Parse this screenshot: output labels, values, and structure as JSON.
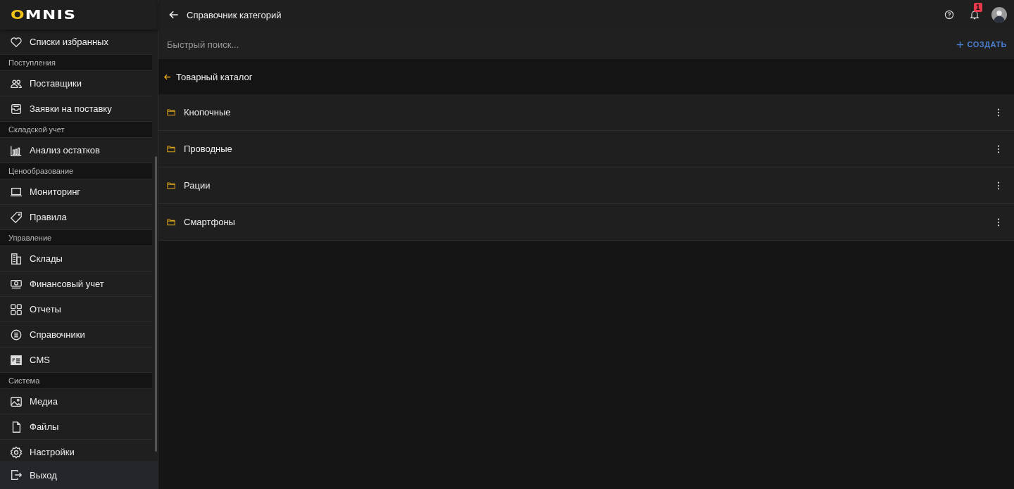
{
  "logo": "OMNIS",
  "sidebar": {
    "items": [
      {
        "kind": "item",
        "label": "Списки избранных"
      },
      {
        "kind": "section",
        "label": "Поступления"
      },
      {
        "kind": "item",
        "label": "Поставщики"
      },
      {
        "kind": "item",
        "label": "Заявки на поставку"
      },
      {
        "kind": "section",
        "label": "Складской учет"
      },
      {
        "kind": "item",
        "label": "Анализ остатков"
      },
      {
        "kind": "section",
        "label": "Ценообразование"
      },
      {
        "kind": "item",
        "label": "Мониторинг"
      },
      {
        "kind": "item",
        "label": "Правила"
      },
      {
        "kind": "section",
        "label": "Управление"
      },
      {
        "kind": "item",
        "label": "Склады"
      },
      {
        "kind": "item",
        "label": "Финансовый учет"
      },
      {
        "kind": "item",
        "label": "Отчеты"
      },
      {
        "kind": "item",
        "label": "Справочники"
      },
      {
        "kind": "item",
        "label": "CMS"
      },
      {
        "kind": "section",
        "label": "Система"
      },
      {
        "kind": "item",
        "label": "Медиа"
      },
      {
        "kind": "item",
        "label": "Файлы"
      },
      {
        "kind": "item",
        "label": "Настройки"
      }
    ],
    "logout": "Выход"
  },
  "header": {
    "title": "Справочник категорий",
    "notifications": "1"
  },
  "search": {
    "placeholder": "Быстрый поиск..."
  },
  "create_button": "СОЗДАТЬ",
  "breadcrumb": "Товарный каталог",
  "categories": [
    {
      "name": "Кнопочные"
    },
    {
      "name": "Проводные"
    },
    {
      "name": "Рации"
    },
    {
      "name": "Смартфоны"
    }
  ]
}
